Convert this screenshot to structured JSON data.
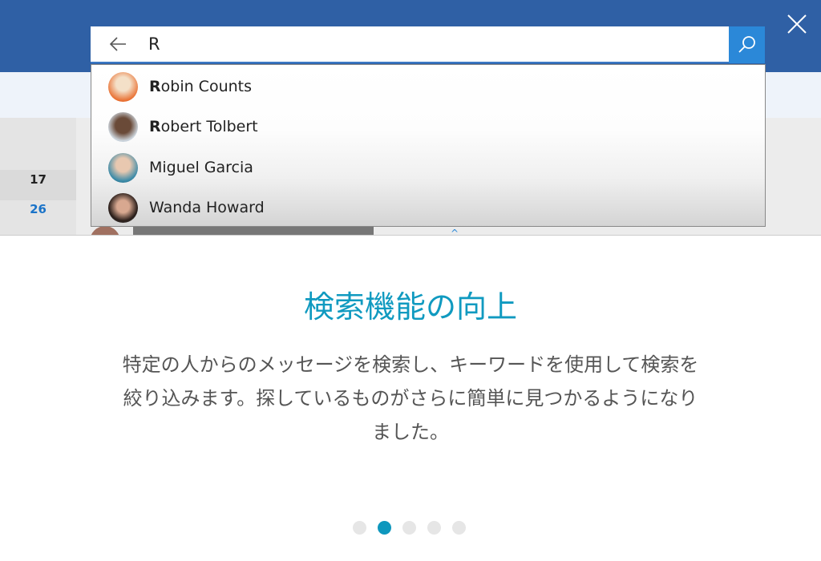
{
  "background": {
    "dates": [
      "17",
      "26"
    ]
  },
  "search": {
    "query": "R",
    "back_icon": "arrow-left-icon",
    "search_icon": "search-icon",
    "accent": "#2b88d8"
  },
  "suggestions": [
    {
      "match": "R",
      "rest": "obin Counts"
    },
    {
      "match": "R",
      "rest": "obert Tolbert"
    },
    {
      "match": "",
      "rest": "Miguel Garcia"
    },
    {
      "match": "",
      "rest": "Wanda Howard"
    }
  ],
  "close_icon": "close-icon",
  "intro": {
    "title": "検索機能の向上",
    "body": "特定の人からのメッセージを検索し、キーワードを使用して検索を絞り込みます。探しているものがさらに簡単に見つかるようになりました。",
    "title_color": "#109ac0",
    "pages": 5,
    "current_page": 2
  }
}
